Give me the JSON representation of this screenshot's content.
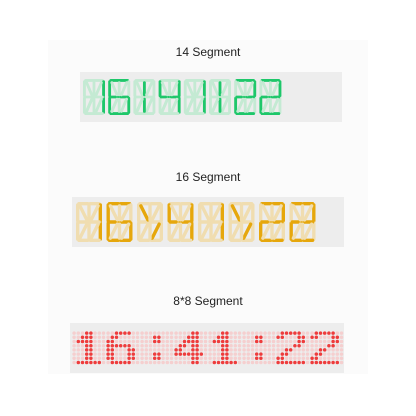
{
  "displays": [
    {
      "title": "14 Segment",
      "value": "16:41:22",
      "on_color": "#1ec76a",
      "off_color": "#c4ead3"
    },
    {
      "title": "16 Segment",
      "value": "16:41:22",
      "on_color": "#e6a70c",
      "off_color": "#f0ddb0"
    },
    {
      "title": "8*8 Segment",
      "value": "16:41:22",
      "on_color": "#ee3c3c",
      "off_color": "#f5cfcf"
    }
  ]
}
